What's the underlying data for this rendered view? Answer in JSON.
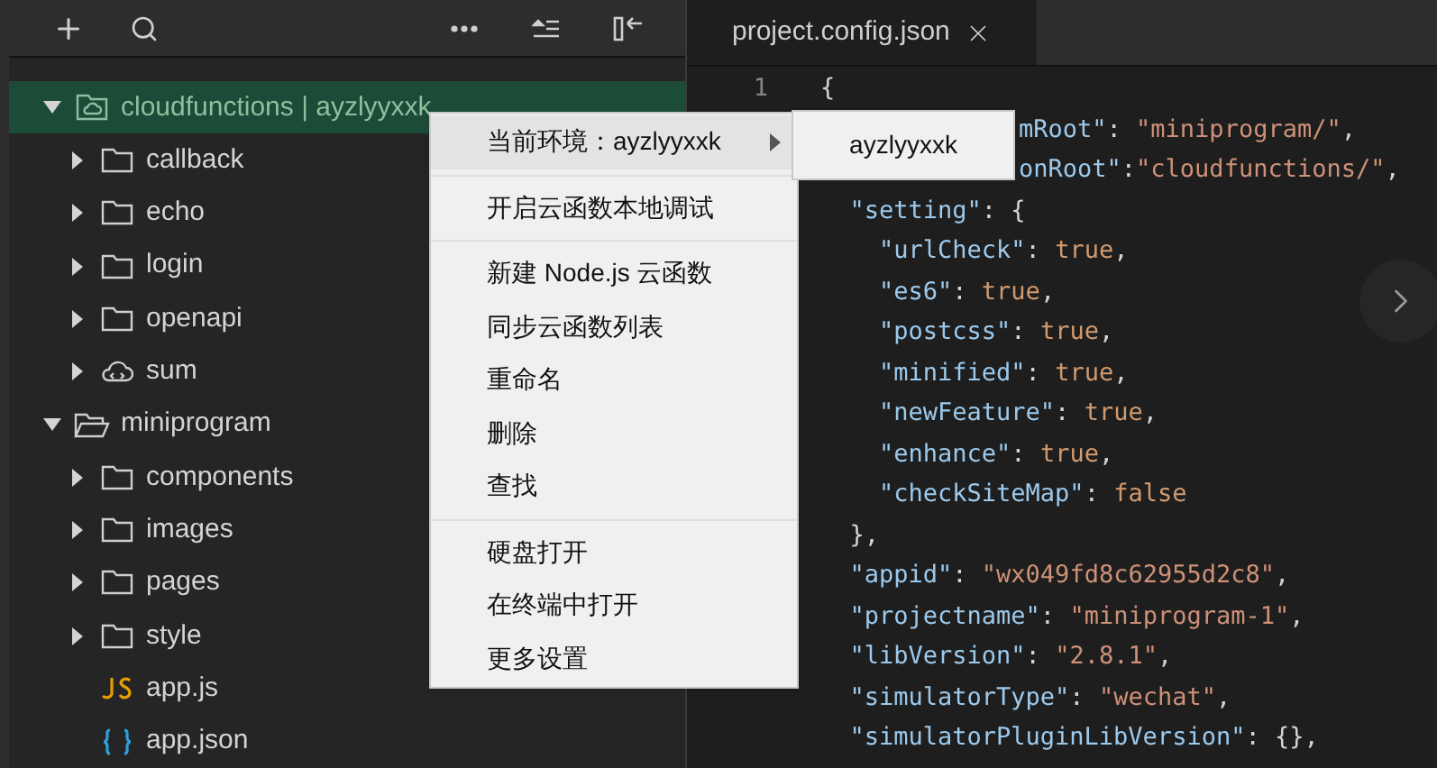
{
  "toolbar": {
    "buttons": [
      {
        "kind": "plus"
      },
      {
        "kind": "search"
      },
      {
        "kind": "more"
      },
      {
        "kind": "collapse"
      },
      {
        "kind": "panel"
      }
    ]
  },
  "tree": [
    {
      "label": "cloudfunctions | ayzlyyxxk",
      "kind": "cloud-root",
      "expanded": true,
      "selected": true,
      "children": [
        {
          "label": "callback",
          "kind": "folder",
          "expanded": false,
          "selected": false
        },
        {
          "label": "echo",
          "kind": "folder",
          "expanded": false,
          "selected": false
        },
        {
          "label": "login",
          "kind": "folder",
          "expanded": false,
          "selected": false
        },
        {
          "label": "openapi",
          "kind": "folder",
          "expanded": false,
          "selected": false
        },
        {
          "label": "sum",
          "kind": "cloud",
          "expanded": false,
          "selected": false
        }
      ]
    },
    {
      "label": "miniprogram",
      "kind": "folder",
      "expanded": true,
      "selected": false,
      "children": [
        {
          "label": "components",
          "kind": "folder",
          "expanded": false,
          "selected": false
        },
        {
          "label": "images",
          "kind": "folder",
          "expanded": false,
          "selected": false
        },
        {
          "label": "pages",
          "kind": "folder",
          "expanded": false,
          "selected": false
        },
        {
          "label": "style",
          "kind": "folder",
          "expanded": false,
          "selected": false
        },
        {
          "label": "app.js",
          "kind": "js",
          "selected": false
        },
        {
          "label": "app.json",
          "kind": "json",
          "selected": false
        }
      ]
    }
  ],
  "tabs": [
    {
      "label": "project.config.json",
      "selected": true
    }
  ],
  "editor": {
    "line_numbers": [
      "1"
    ],
    "lines": [
      [
        {
          "t": "{",
          "kind": "punct"
        }
      ],
      [
        {
          "t": "mRoot\"",
          "kind": "key"
        },
        {
          "t": ": ",
          "kind": "punct"
        },
        {
          "t": "\"miniprogram/\"",
          "kind": "string"
        },
        {
          "t": ",",
          "kind": "punct"
        }
      ],
      [
        {
          "t": "onRoot\"",
          "kind": "key"
        },
        {
          "t": ":",
          "kind": "punct"
        },
        {
          "t": "\"cloudfunctions/\"",
          "kind": "string"
        },
        {
          "t": ",",
          "kind": "punct"
        }
      ],
      [
        {
          "t": "  \"setting\"",
          "kind": "key"
        },
        {
          "t": ": {",
          "kind": "punct"
        }
      ],
      [
        {
          "t": "    \"urlCheck\"",
          "kind": "key"
        },
        {
          "t": ": ",
          "kind": "punct"
        },
        {
          "t": "true",
          "kind": "literal"
        },
        {
          "t": ",",
          "kind": "punct"
        }
      ],
      [
        {
          "t": "    \"es6\"",
          "kind": "key"
        },
        {
          "t": ": ",
          "kind": "punct"
        },
        {
          "t": "true",
          "kind": "literal"
        },
        {
          "t": ",",
          "kind": "punct"
        }
      ],
      [
        {
          "t": "    \"postcss\"",
          "kind": "key"
        },
        {
          "t": ": ",
          "kind": "punct"
        },
        {
          "t": "true",
          "kind": "literal"
        },
        {
          "t": ",",
          "kind": "punct"
        }
      ],
      [
        {
          "t": "    \"minified\"",
          "kind": "key"
        },
        {
          "t": ": ",
          "kind": "punct"
        },
        {
          "t": "true",
          "kind": "literal"
        },
        {
          "t": ",",
          "kind": "punct"
        }
      ],
      [
        {
          "t": "    \"newFeature\"",
          "kind": "key"
        },
        {
          "t": ": ",
          "kind": "punct"
        },
        {
          "t": "true",
          "kind": "literal"
        },
        {
          "t": ",",
          "kind": "punct"
        }
      ],
      [
        {
          "t": "    \"enhance\"",
          "kind": "key"
        },
        {
          "t": ": ",
          "kind": "punct"
        },
        {
          "t": "true",
          "kind": "literal"
        },
        {
          "t": ",",
          "kind": "punct"
        }
      ],
      [
        {
          "t": "    \"checkSiteMap\"",
          "kind": "key"
        },
        {
          "t": ": ",
          "kind": "punct"
        },
        {
          "t": "false",
          "kind": "literal"
        }
      ],
      [
        {
          "t": "  },",
          "kind": "punct"
        }
      ],
      [
        {
          "t": "  \"appid\"",
          "kind": "key"
        },
        {
          "t": ": ",
          "kind": "punct"
        },
        {
          "t": "\"wx049fd8c62955d2c8\"",
          "kind": "string"
        },
        {
          "t": ",",
          "kind": "punct"
        }
      ],
      [
        {
          "t": "  \"projectname\"",
          "kind": "key"
        },
        {
          "t": ": ",
          "kind": "punct"
        },
        {
          "t": "\"miniprogram-1\"",
          "kind": "string"
        },
        {
          "t": ",",
          "kind": "punct"
        }
      ],
      [
        {
          "t": "  \"libVersion\"",
          "kind": "key"
        },
        {
          "t": ": ",
          "kind": "punct"
        },
        {
          "t": "\"2.8.1\"",
          "kind": "string"
        },
        {
          "t": ",",
          "kind": "punct"
        }
      ],
      [
        {
          "t": "  \"simulatorType\"",
          "kind": "key"
        },
        {
          "t": ": ",
          "kind": "punct"
        },
        {
          "t": "\"wechat\"",
          "kind": "string"
        },
        {
          "t": ",",
          "kind": "punct"
        }
      ],
      [
        {
          "t": "  \"simulatorPluginLibVersion\"",
          "kind": "key"
        },
        {
          "t": ": {},",
          "kind": "punct"
        }
      ]
    ]
  },
  "context_menu": {
    "groups": [
      [
        {
          "label": "当前环境：ayzlyyxxk",
          "highlighted": true,
          "has_submenu": true
        }
      ],
      [
        {
          "label": "开启云函数本地调试",
          "highlighted": false,
          "has_submenu": false
        }
      ],
      [
        {
          "label": "新建 Node.js 云函数",
          "highlighted": false,
          "has_submenu": false
        },
        {
          "label": "同步云函数列表",
          "highlighted": false,
          "has_submenu": false
        },
        {
          "label": "重命名",
          "highlighted": false,
          "has_submenu": false
        },
        {
          "label": "删除",
          "highlighted": false,
          "has_submenu": false
        },
        {
          "label": "查找",
          "highlighted": false,
          "has_submenu": false
        }
      ],
      [
        {
          "label": "硬盘打开",
          "highlighted": false,
          "has_submenu": false
        },
        {
          "label": "在终端中打开",
          "highlighted": false,
          "has_submenu": false
        },
        {
          "label": "更多设置",
          "highlighted": false,
          "has_submenu": false
        }
      ]
    ]
  },
  "submenu": {
    "items": [
      {
        "label": "ayzlyyxxk"
      }
    ]
  }
}
